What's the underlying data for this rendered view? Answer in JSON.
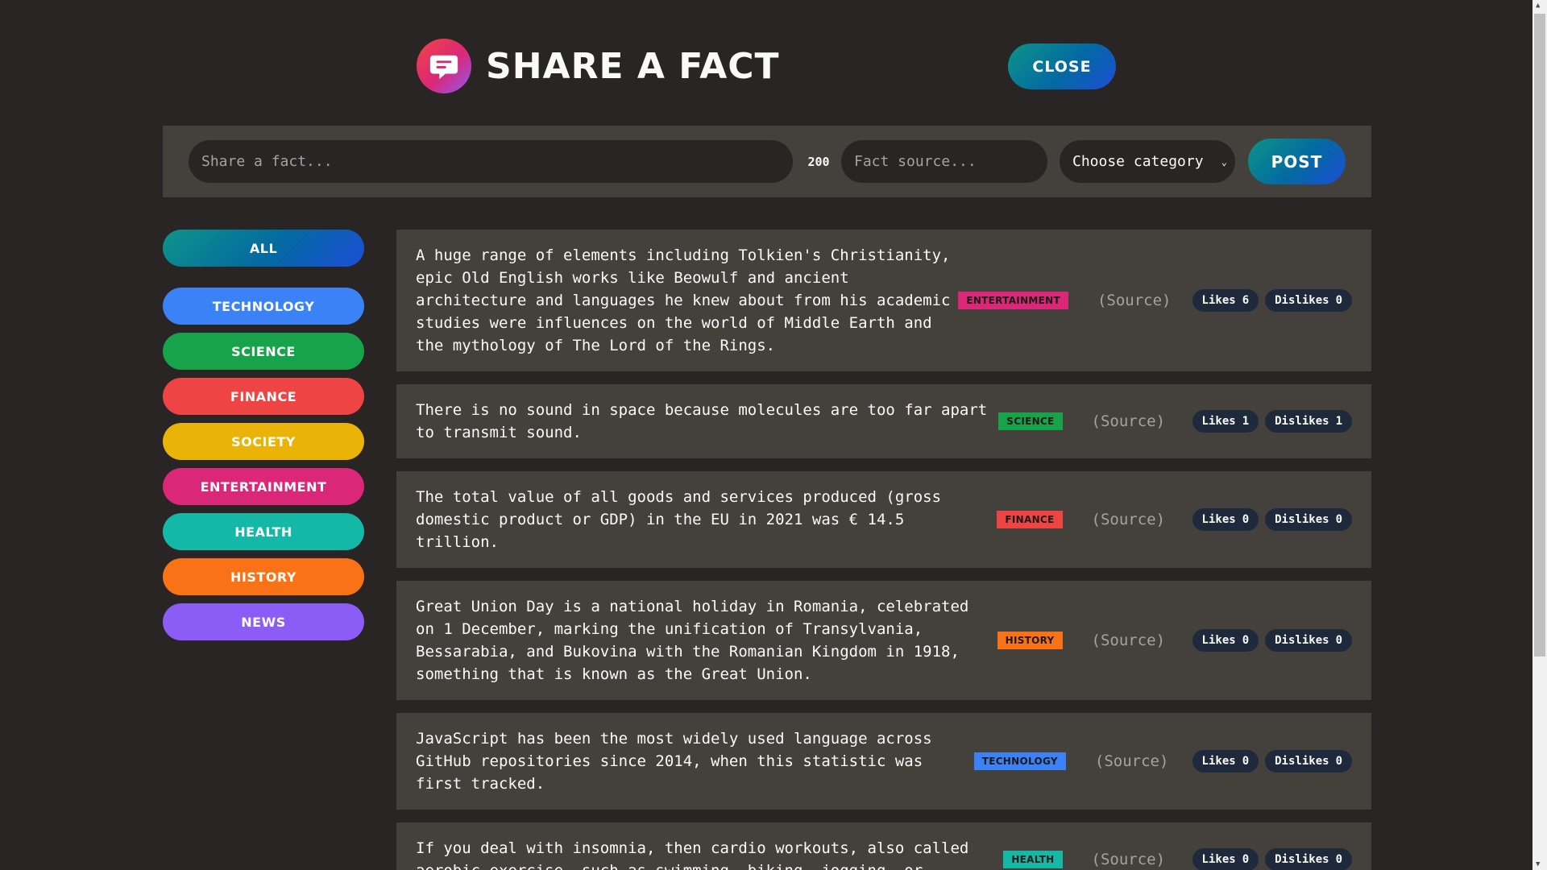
{
  "header": {
    "title": "SHARE A FACT",
    "logo_icon": "chat-bubble-icon",
    "close_label": "CLOSE"
  },
  "form": {
    "fact_placeholder": "Share a fact...",
    "char_count": "200",
    "source_placeholder": "Fact source...",
    "category_placeholder": "Choose category",
    "post_label": "POST"
  },
  "sidebar": {
    "all_label": "ALL",
    "categories": [
      {
        "label": "TECHNOLOGY",
        "color": "#3b82f6"
      },
      {
        "label": "SCIENCE",
        "color": "#16a34a"
      },
      {
        "label": "FINANCE",
        "color": "#ef4444"
      },
      {
        "label": "SOCIETY",
        "color": "#eab308"
      },
      {
        "label": "ENTERTAINMENT",
        "color": "#db2777"
      },
      {
        "label": "HEALTH",
        "color": "#14b8a6"
      },
      {
        "label": "HISTORY",
        "color": "#f97316"
      },
      {
        "label": "NEWS",
        "color": "#8b5cf6"
      }
    ]
  },
  "facts": [
    {
      "text": "A huge range of elements including Tolkien's Christianity, epic Old English works like Beowulf and ancient architecture and languages he knew about from his academic studies were influences on the world of Middle Earth and the mythology of The Lord of the Rings.",
      "category": "ENTERTAINMENT",
      "color": "#db2777",
      "source": "(Source)",
      "likes_label": "Likes",
      "likes": "6",
      "dislikes_label": "Dislikes",
      "dislikes": "0"
    },
    {
      "text": "There is no sound in space because molecules are too far apart to transmit sound.",
      "category": "SCIENCE",
      "color": "#16a34a",
      "source": "(Source)",
      "likes_label": "Likes",
      "likes": "1",
      "dislikes_label": "Dislikes",
      "dislikes": "1"
    },
    {
      "text": "The total value of all goods and services produced (gross domestic product or GDP) in the EU in 2021 was € 14.5 trillion.",
      "category": "FINANCE",
      "color": "#ef4444",
      "source": "(Source)",
      "likes_label": "Likes",
      "likes": "0",
      "dislikes_label": "Dislikes",
      "dislikes": "0"
    },
    {
      "text": "Great Union Day is a national holiday in Romania, celebrated on 1 December, marking the unification of Transylvania, Bessarabia, and Bukovina with the Romanian Kingdom in 1918, something that is known as the Great Union.",
      "category": "HISTORY",
      "color": "#f97316",
      "source": "(Source)",
      "likes_label": "Likes",
      "likes": "0",
      "dislikes_label": "Dislikes",
      "dislikes": "0"
    },
    {
      "text": "JavaScript has been the most widely used language across GitHub repositories since 2014, when this statistic was first tracked.",
      "category": "TECHNOLOGY",
      "color": "#3b82f6",
      "source": "(Source)",
      "likes_label": "Likes",
      "likes": "0",
      "dislikes_label": "Dislikes",
      "dislikes": "0"
    },
    {
      "text": "If you deal with insomnia, then cardio workouts, also called aerobic exercise, such as swimming, biking, jogging, or",
      "category": "HEALTH",
      "color": "#14b8a6",
      "source": "(Source)",
      "likes_label": "Likes",
      "likes": "0",
      "dislikes_label": "Dislikes",
      "dislikes": "0"
    }
  ]
}
